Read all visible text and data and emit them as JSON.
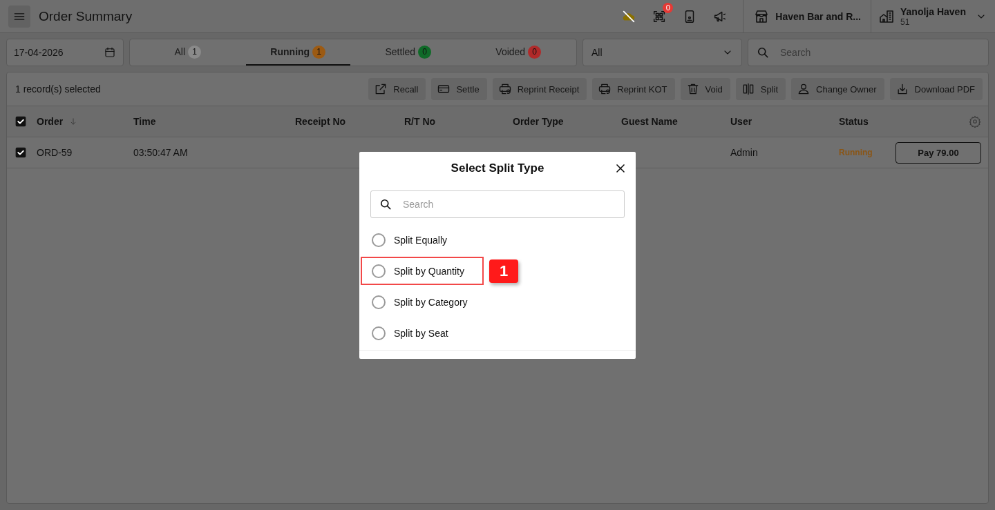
{
  "header": {
    "title": "Order Summary",
    "qr_badge": "0",
    "outlet": "Haven Bar and R...",
    "account": {
      "name": "Yanolja Haven",
      "sub": "51"
    }
  },
  "filters": {
    "date": "17-04-2026",
    "tabs": [
      {
        "label": "All",
        "count": "1",
        "color": "#8a8a8a",
        "selected": false
      },
      {
        "label": "Running",
        "count": "1",
        "color": "#9c5a12",
        "selected": true
      },
      {
        "label": "Settled",
        "count": "0",
        "color": "#0f6a28",
        "selected": false
      },
      {
        "label": "Voided",
        "count": "0",
        "color": "#b02a2a",
        "selected": false
      }
    ],
    "type_select": "All",
    "search": {
      "placeholder": "Search"
    }
  },
  "toolbar": {
    "selection": "1 record(s) selected",
    "actions": [
      {
        "kind": "recall",
        "label": "Recall"
      },
      {
        "kind": "settle",
        "label": "Settle"
      },
      {
        "kind": "print",
        "label": "Reprint Receipt"
      },
      {
        "kind": "print",
        "label": "Reprint KOT"
      },
      {
        "kind": "void",
        "label": "Void"
      },
      {
        "kind": "split",
        "label": "Split"
      },
      {
        "kind": "owner",
        "label": "Change Owner"
      },
      {
        "kind": "download",
        "label": "Download PDF"
      }
    ]
  },
  "table": {
    "all_checked": true,
    "columns": [
      "Order",
      "Time",
      "Receipt No",
      "R/T No",
      "Order Type",
      "Guest Name",
      "User",
      "Status"
    ],
    "rows": [
      {
        "checked": true,
        "order": "ORD-59",
        "time": "03:50:47 AM",
        "receipt": "",
        "rt": "",
        "order_type": "",
        "guest": "",
        "user": "Admin",
        "status": "Running",
        "pay": "Pay 79.00"
      }
    ]
  },
  "dialog": {
    "title": "Select Split Type",
    "search": {
      "placeholder": "Search"
    },
    "options": [
      {
        "label": "Split Equally",
        "selected": false,
        "highlighted": false
      },
      {
        "label": "Split by Quantity",
        "selected": false,
        "highlighted": true,
        "callout": "1"
      },
      {
        "label": "Split by Category",
        "selected": false,
        "highlighted": false
      },
      {
        "label": "Split by Seat",
        "selected": false,
        "highlighted": false
      }
    ]
  }
}
